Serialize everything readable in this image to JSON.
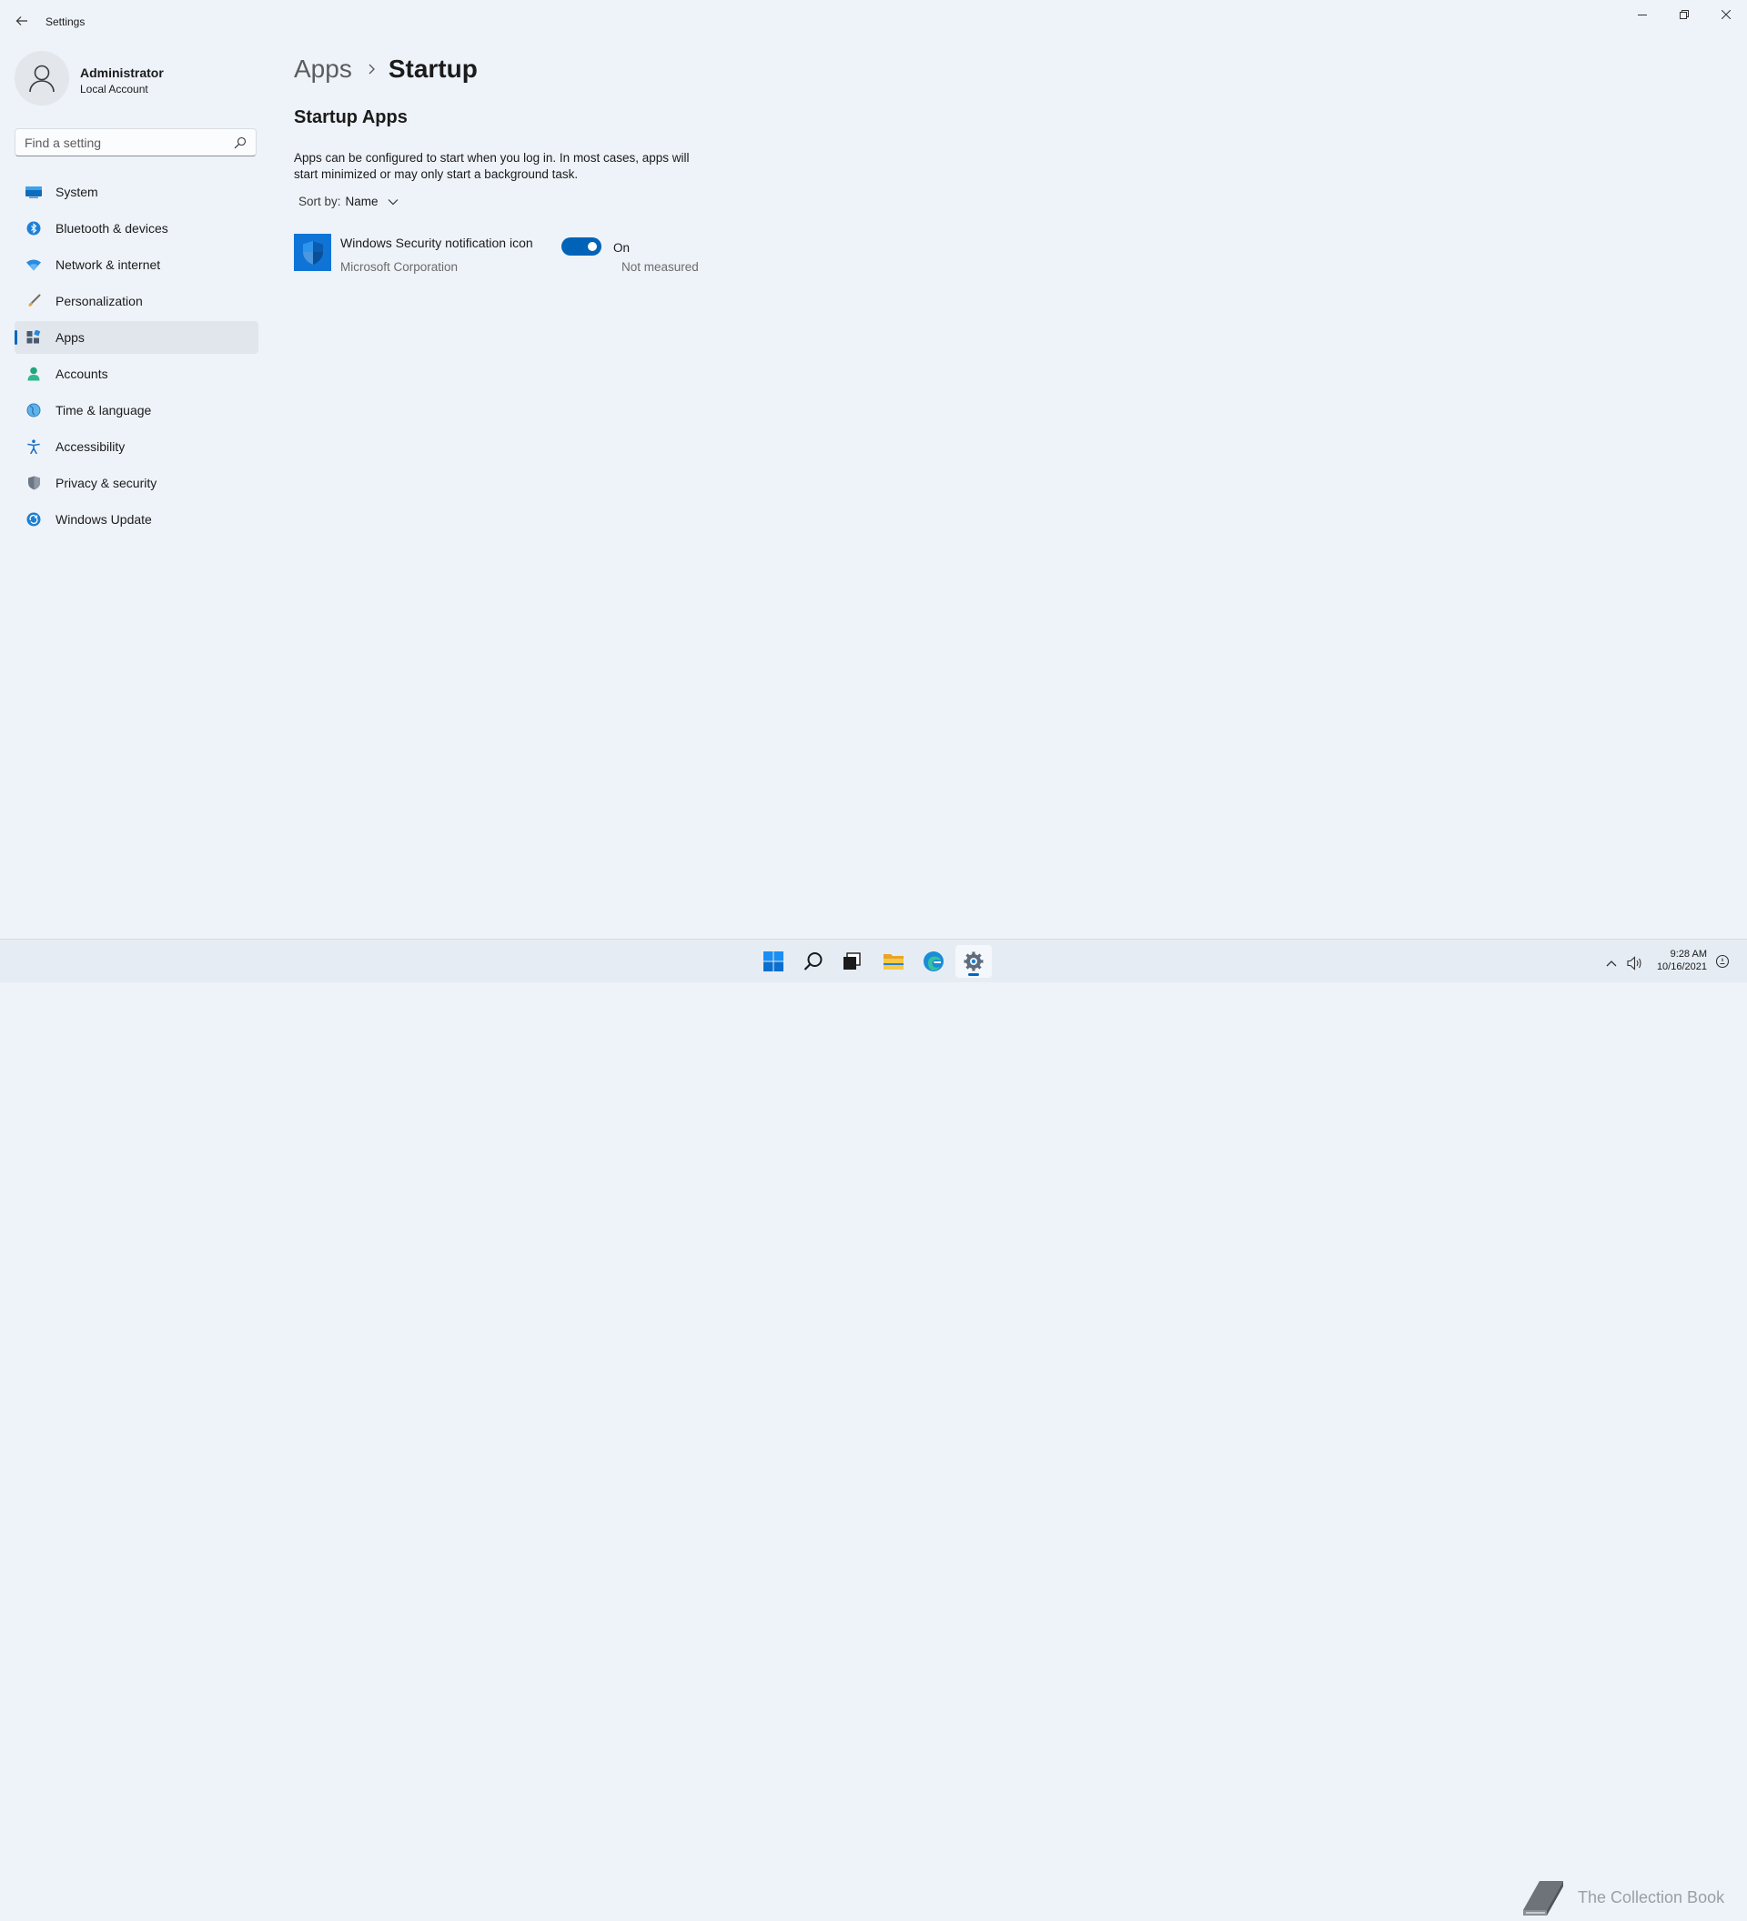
{
  "window": {
    "title": "Settings"
  },
  "profile": {
    "name": "Administrator",
    "account_type": "Local Account"
  },
  "search": {
    "placeholder": "Find a setting"
  },
  "sidebar": {
    "items": [
      {
        "label": "System",
        "icon": "system-icon"
      },
      {
        "label": "Bluetooth & devices",
        "icon": "bluetooth-icon"
      },
      {
        "label": "Network & internet",
        "icon": "network-icon"
      },
      {
        "label": "Personalization",
        "icon": "brush-icon"
      },
      {
        "label": "Apps",
        "icon": "apps-icon",
        "active": true
      },
      {
        "label": "Accounts",
        "icon": "accounts-icon"
      },
      {
        "label": "Time & language",
        "icon": "time-language-icon"
      },
      {
        "label": "Accessibility",
        "icon": "accessibility-icon"
      },
      {
        "label": "Privacy & security",
        "icon": "shield-icon"
      },
      {
        "label": "Windows Update",
        "icon": "update-icon"
      }
    ]
  },
  "breadcrumb": {
    "parent": "Apps",
    "current": "Startup"
  },
  "main": {
    "section_title": "Startup Apps",
    "description": "Apps can be configured to start when you log in. In most cases, apps will start minimized or may only start a background task.",
    "sort": {
      "label": "Sort by:",
      "value": "Name"
    },
    "apps": [
      {
        "name": "Windows Security notification icon",
        "publisher": "Microsoft Corporation",
        "enabled": true,
        "state_label": "On",
        "impact": "Not measured"
      }
    ]
  },
  "taskbar": {
    "apps": [
      "start-icon",
      "search-icon",
      "task-view-icon",
      "file-explorer-icon",
      "edge-icon",
      "settings-icon"
    ],
    "active_app": "settings-icon",
    "watermark": "The Collection Book",
    "clock": {
      "time": "9:28 AM",
      "date": "10/16/2021"
    }
  },
  "colors": {
    "accent": "#0067c0",
    "background": "#eef3f9",
    "toggle_on": "#0063b8",
    "app_tile": "#0f74d6"
  }
}
